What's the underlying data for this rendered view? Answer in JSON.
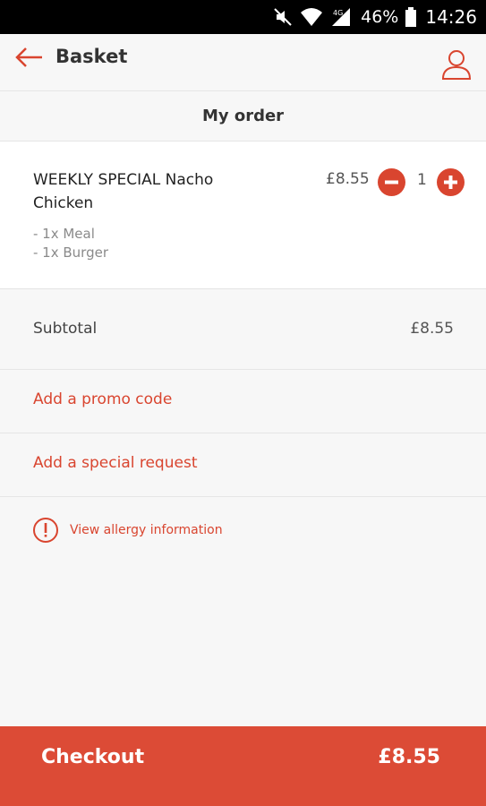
{
  "status_bar": {
    "network_label": "4G",
    "battery": "46%",
    "time": "14:26"
  },
  "header": {
    "title": "Basket"
  },
  "section": {
    "title": "My order"
  },
  "order": {
    "items": [
      {
        "name": "WEEKLY SPECIAL Nacho Chicken",
        "price": "£8.55",
        "quantity": "1",
        "options": [
          "- 1x Meal",
          "- 1x Burger"
        ]
      }
    ]
  },
  "summary": {
    "subtotal_label": "Subtotal",
    "subtotal_value": "£8.55"
  },
  "actions": {
    "promo_label": "Add a promo code",
    "request_label": "Add a special request",
    "allergy_label": "View allergy information"
  },
  "checkout": {
    "label": "Checkout",
    "total": "£8.55"
  },
  "colors": {
    "accent": "#d9452f",
    "checkout_bg": "#dc4b36",
    "background": "#f7f7f7"
  },
  "icons": {
    "back": "back-arrow-icon",
    "account": "user-icon",
    "minus": "minus-icon",
    "plus": "plus-icon",
    "allergy": "alert-circle-icon"
  }
}
